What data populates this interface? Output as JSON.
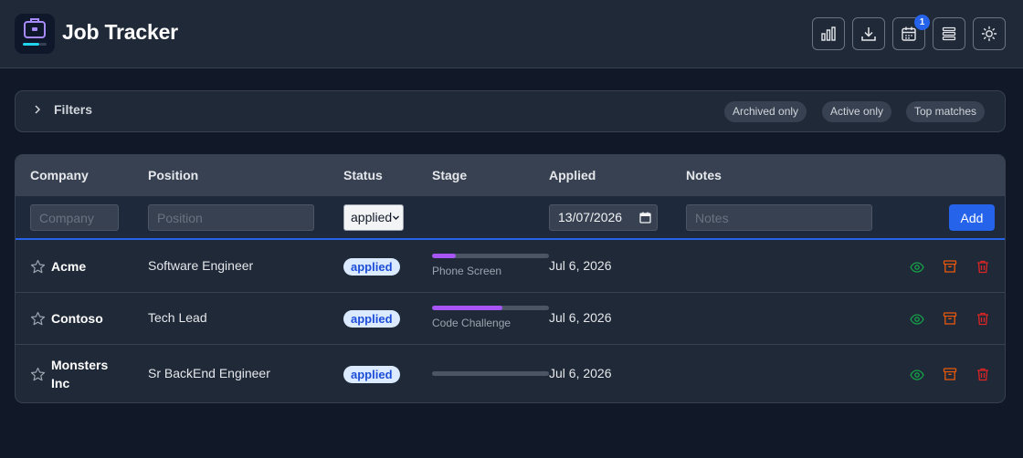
{
  "app": {
    "title": "Job Tracker"
  },
  "header": {
    "buttons": [
      {
        "icon": "bar-chart-icon"
      },
      {
        "icon": "download-icon"
      },
      {
        "icon": "calendar-icon",
        "badge": "1"
      },
      {
        "icon": "stack-icon"
      },
      {
        "icon": "sun-icon"
      }
    ]
  },
  "filters": {
    "label": "Filters",
    "chips": [
      "Archived only",
      "Active only",
      "Top matches"
    ]
  },
  "table": {
    "columns": [
      "Company",
      "Position",
      "Status",
      "Stage",
      "Applied",
      "Notes"
    ],
    "add_row": {
      "company_placeholder": "Company",
      "position_placeholder": "Position",
      "status_value": "applied",
      "date_value": "13/07/2026",
      "notes_placeholder": "Notes",
      "add_label": "Add"
    },
    "rows": [
      {
        "company": "Acme",
        "position": "Software Engineer",
        "status": "applied",
        "stage": "Phone Screen",
        "stage_progress": 0.2,
        "applied": "Jul 6, 2026"
      },
      {
        "company": "Contoso",
        "position": "Tech Lead",
        "status": "applied",
        "stage": "Code Challenge",
        "stage_progress": 0.6,
        "applied": "Jul 6, 2026"
      },
      {
        "company": "Monsters Inc",
        "position": "Sr BackEnd Engineer",
        "status": "applied",
        "stage": "",
        "stage_progress": 0,
        "applied": "Jul 6, 2026"
      }
    ]
  },
  "colors": {
    "accent": "#2563eb",
    "stage_fill": "#a855f7",
    "view_icon": "#16a34a",
    "archive_icon": "#ea580c",
    "delete_icon": "#dc2626"
  }
}
